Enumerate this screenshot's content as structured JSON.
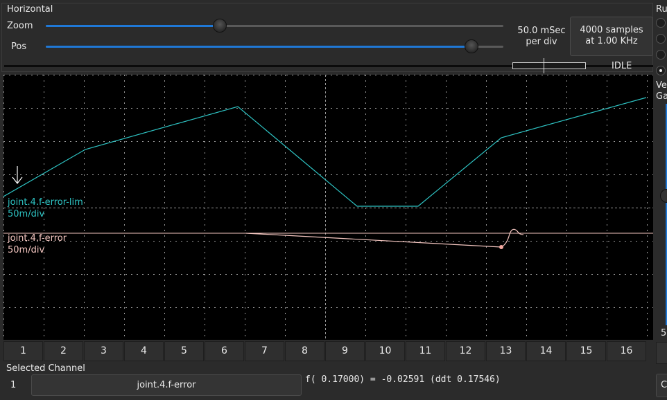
{
  "horizontal": {
    "title": "Horizontal",
    "zoom_label": "Zoom",
    "pos_label": "Pos",
    "zoom_value": 0.38,
    "pos_value": 0.93,
    "time_per_div_line1": "50.0 mSec",
    "time_per_div_line2": "per div",
    "samples_line1": "4000 samples",
    "samples_line2": "at 1.00 KHz",
    "status": "IDLE"
  },
  "right_panel": {
    "run_label": "Ru",
    "vertical_label": "Ve",
    "gain_label": "Ga",
    "value_label": "5",
    "bottom_label": "C"
  },
  "channels": {
    "ch1": {
      "name": "joint.4.f-error-lim",
      "scale": "50m/div",
      "color": "#2ec4c4"
    },
    "ch2": {
      "name": "joint.4.f-error",
      "scale": "50m/div",
      "color": "#f4c6c0"
    }
  },
  "channel_buttons": [
    "1",
    "2",
    "3",
    "4",
    "5",
    "6",
    "7",
    "8",
    "9",
    "10",
    "11",
    "12",
    "13",
    "14",
    "15",
    "16"
  ],
  "selected_channel": {
    "title": "Selected Channel",
    "number": "1",
    "name": "joint.4.f-error",
    "readout": "f( 0.17000) = -0.02591 (ddt  0.17546)"
  },
  "colors": {
    "background": "#2b2b2b",
    "scope_background": "#000000",
    "grid": "#9a9a9a",
    "accent": "#1f78d6"
  }
}
